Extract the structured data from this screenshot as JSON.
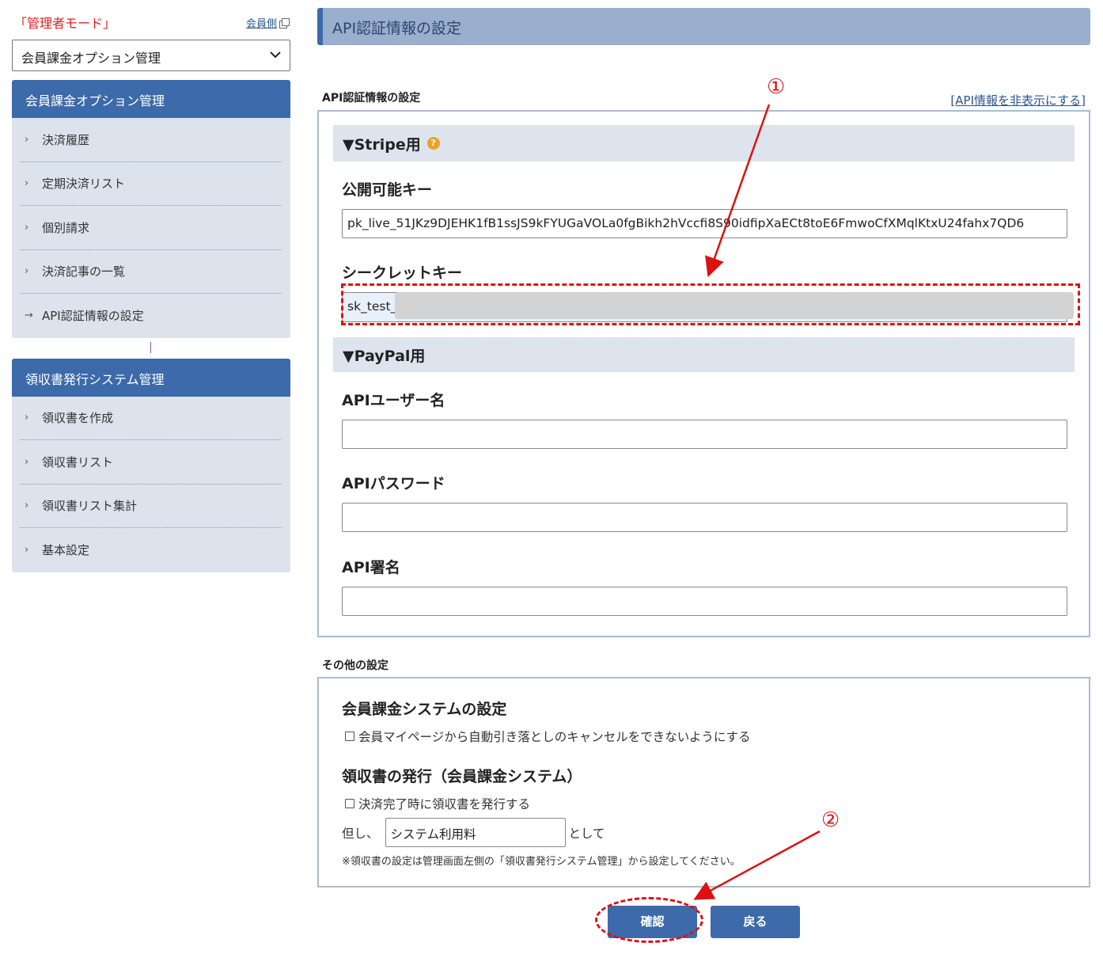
{
  "sidebar": {
    "mode_label": "「管理者モード」",
    "member_link": "会員側",
    "select_value": "会員課金オプション管理",
    "menus": [
      {
        "title": "会員課金オプション管理",
        "items": [
          {
            "label": "決済履歴",
            "active": false
          },
          {
            "label": "定期決済リスト",
            "active": false
          },
          {
            "label": "個別請求",
            "active": false
          },
          {
            "label": "決済記事の一覧",
            "active": false
          },
          {
            "label": "API認証情報の設定",
            "active": true
          }
        ]
      },
      {
        "title": "領収書発行システム管理",
        "items": [
          {
            "label": "領収書を作成",
            "active": false
          },
          {
            "label": "領収書リスト",
            "active": false
          },
          {
            "label": "領収書リスト集計",
            "active": false
          },
          {
            "label": "基本設定",
            "active": false
          }
        ]
      }
    ]
  },
  "header": {
    "title": "API認証情報の設定"
  },
  "api_section": {
    "title": "API認証情報の設定",
    "hide_link": "[API情報を非表示にする]",
    "stripe": {
      "heading": "▼Stripe用",
      "help_icon": "?",
      "public_key_label": "公開可能キー",
      "public_key_value": "pk_live_51JKz9DJEHK1fB1ssJS9kFYUGaVOLa0fgBikh2hVccfi8S90idfipXaECt8toE6FmwoCfXMqlKtxU24fahx7QD6",
      "secret_key_label": "シークレットキー",
      "secret_key_value": "sk_test_"
    },
    "paypal": {
      "heading": "▼PayPal用",
      "user_label": "APIユーザー名",
      "user_value": "",
      "password_label": "APIパスワード",
      "password_value": "",
      "signature_label": "API署名",
      "signature_value": ""
    }
  },
  "other_section": {
    "title": "その他の設定",
    "member_system_title": "会員課金システムの設定",
    "member_system_checkbox": "会員マイページから自動引き落としのキャンセルをできないようにする",
    "receipt_title": "領収書の発行（会員課金システム）",
    "receipt_checkbox": "決済完了時に領収書を発行する",
    "proviso_prefix": "但し、",
    "proviso_value": "システム利用料",
    "proviso_suffix": "として",
    "note": "※領収書の設定は管理画面左側の「領収書発行システム管理」から設定してください。"
  },
  "buttons": {
    "confirm": "確認",
    "back": "戻る"
  },
  "annotations": {
    "marker1": "①",
    "marker2": "②"
  },
  "colors": {
    "accent": "#3c6aaa",
    "annotation": "#e01010"
  }
}
